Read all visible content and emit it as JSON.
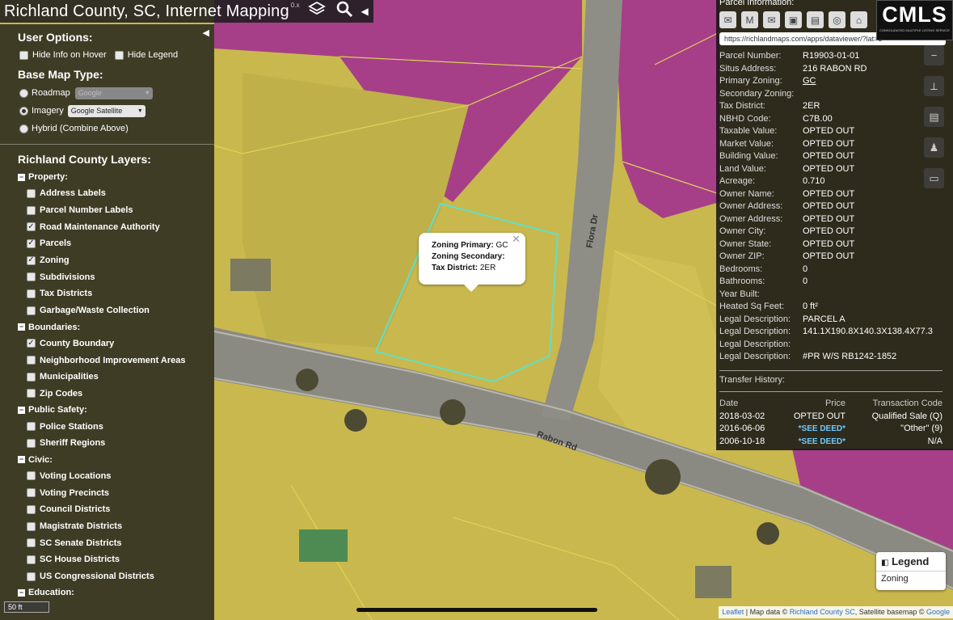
{
  "titlebar": {
    "title": "Richland County, SC, Internet Mapping",
    "version": "0.x",
    "layers_icon": "layers-icon",
    "search_icon": "search-icon"
  },
  "user_options": {
    "heading": "User Options:",
    "hide_info": "Hide Info on Hover",
    "hide_legend": "Hide Legend"
  },
  "base_map": {
    "heading": "Base Map Type:",
    "roadmap": "Roadmap",
    "roadmap_select": "Google",
    "imagery": "Imagery",
    "imagery_select": "Google Satellite",
    "hybrid": "Hybrid (Combine Above)"
  },
  "layers": {
    "heading": "Richland County Layers:",
    "groups": [
      {
        "name": "Property:",
        "items": [
          {
            "label": "Address Labels",
            "checked": false
          },
          {
            "label": "Parcel Number Labels",
            "checked": false
          },
          {
            "label": "Road Maintenance Authority",
            "checked": true
          },
          {
            "label": "Parcels",
            "checked": true
          },
          {
            "label": "Zoning",
            "checked": true
          },
          {
            "label": "Subdivisions",
            "checked": false
          },
          {
            "label": "Tax Districts",
            "checked": false
          },
          {
            "label": "Garbage/Waste Collection",
            "checked": false
          }
        ]
      },
      {
        "name": "Boundaries:",
        "items": [
          {
            "label": "County Boundary",
            "checked": true
          },
          {
            "label": "Neighborhood Improvement Areas",
            "checked": false
          },
          {
            "label": "Municipalities",
            "checked": false
          },
          {
            "label": "Zip Codes",
            "checked": false
          }
        ]
      },
      {
        "name": "Public Safety:",
        "items": [
          {
            "label": "Police Stations",
            "checked": false
          },
          {
            "label": "Sheriff Regions",
            "checked": false
          }
        ]
      },
      {
        "name": "Civic:",
        "items": [
          {
            "label": "Voting Locations",
            "checked": false
          },
          {
            "label": "Voting Precincts",
            "checked": false
          },
          {
            "label": "Council Districts",
            "checked": false
          },
          {
            "label": "Magistrate Districts",
            "checked": false
          },
          {
            "label": "SC Senate Districts",
            "checked": false
          },
          {
            "label": "SC House Districts",
            "checked": false
          },
          {
            "label": "US Congressional Districts",
            "checked": false
          }
        ]
      },
      {
        "name": "Education:",
        "items": []
      }
    ]
  },
  "scale": "50 ft",
  "popup": {
    "zoning_primary_label": "Zoning Primary:",
    "zoning_primary": "GC",
    "zoning_secondary_label": "Zoning Secondary:",
    "zoning_secondary": "",
    "tax_district_label": "Tax District:",
    "tax_district": "2ER"
  },
  "road_labels": {
    "flora": "Flora Dr",
    "rabon": "Rabon Rd"
  },
  "parcel_info": {
    "heading": "Parcel Information:",
    "url": "https://richlandmaps.com/apps/dataviewer/?lat=3",
    "icons": [
      "email-icon",
      "gmail-icon",
      "yahoo-mail-icon",
      "pdf-icon",
      "print-icon",
      "county-seal-icon",
      "home-icon"
    ],
    "fields": [
      {
        "k": "Parcel Number:",
        "v": "R19903-01-01"
      },
      {
        "k": "Situs Address:",
        "v": "216 RABON RD"
      },
      {
        "k": "Primary Zoning:",
        "v": "GC",
        "link": true
      },
      {
        "k": "Secondary Zoning:",
        "v": ""
      },
      {
        "k": "Tax District:",
        "v": "2ER"
      },
      {
        "k": "NBHD Code:",
        "v": "C7B.00"
      },
      {
        "k": "Taxable Value:",
        "v": "OPTED OUT"
      },
      {
        "k": "Market Value:",
        "v": "OPTED OUT"
      },
      {
        "k": "Building Value:",
        "v": "OPTED OUT"
      },
      {
        "k": "Land Value:",
        "v": "OPTED OUT"
      },
      {
        "k": "Acreage:",
        "v": "0.710"
      },
      {
        "k": "Owner Name:",
        "v": "OPTED OUT"
      },
      {
        "k": "Owner Address:",
        "v": "OPTED OUT"
      },
      {
        "k": "Owner Address:",
        "v": "OPTED OUT"
      },
      {
        "k": "Owner City:",
        "v": "OPTED OUT"
      },
      {
        "k": "Owner State:",
        "v": "OPTED OUT"
      },
      {
        "k": "Owner ZIP:",
        "v": "OPTED OUT"
      },
      {
        "k": "Bedrooms:",
        "v": "0"
      },
      {
        "k": "Bathrooms:",
        "v": "0"
      },
      {
        "k": "Year Built:",
        "v": ""
      },
      {
        "k": "Heated Sq Feet:",
        "v": "0 ft²"
      },
      {
        "k": "Legal Description:",
        "v": "PARCEL A"
      },
      {
        "k": "Legal Description:",
        "v": "141.1X190.8X140.3X138.4X77.3"
      },
      {
        "k": "Legal Description:",
        "v": ""
      },
      {
        "k": "Legal Description:",
        "v": "#PR W/S RB1242-1852"
      }
    ],
    "transfer_heading": "Transfer History:",
    "transfer_columns": [
      "Date",
      "Price",
      "Transaction Code"
    ],
    "transfers": [
      {
        "date": "2018-03-02",
        "price": "OPTED OUT",
        "code": "Qualified Sale (Q)",
        "deed": false
      },
      {
        "date": "2016-06-06",
        "price": "*SEE DEED*",
        "code": "\"Other\" (9)",
        "deed": true
      },
      {
        "date": "2006-10-18",
        "price": "*SEE DEED*",
        "code": "N/A",
        "deed": true
      }
    ]
  },
  "logo": {
    "text": "CMLS",
    "subtext": "CONSOLIDATED MULTIPLE LISTING SERVICE"
  },
  "legend": {
    "title": "Legend",
    "item": "Zoning"
  },
  "attribution": {
    "leaflet": "Leaflet",
    "sep": " | Map data © ",
    "county": "Richland County SC",
    "mid": ", Satellite basemap © ",
    "google": "Google"
  },
  "colors": {
    "zoning_yellow": "#d8c94a",
    "zoning_magenta": "#b0438f",
    "parcel_highlight": "#5fe0c8"
  }
}
